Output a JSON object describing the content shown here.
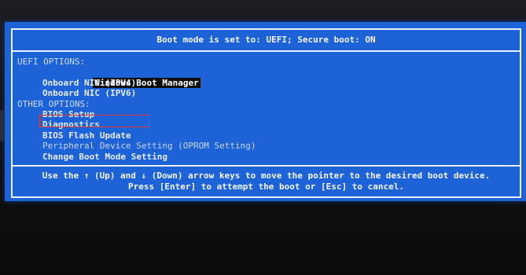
{
  "header": {
    "title": "Boot mode is set to: UEFI; Secure boot: ON"
  },
  "menu": {
    "uefi_section": "UEFI OPTIONS:",
    "uefi_items": [
      {
        "label": "Windows Boot Manager"
      },
      {
        "label": "Onboard NIC (IPV4)"
      },
      {
        "label": "Onboard NIC (IPV6)"
      }
    ],
    "other_section": "OTHER OPTIONS:",
    "other_items": [
      {
        "label": "BIOS Setup"
      },
      {
        "label": "Diagnostics"
      },
      {
        "label": "BIOS Flash Update"
      },
      {
        "label": "Peripheral Device Setting (OPROM Setting)"
      },
      {
        "label": "Change Boot Mode Setting"
      }
    ]
  },
  "footer": {
    "line1": "Use the ↑ (Up) and ↓ (Down) arrow keys to move the pointer to the desired boot device.",
    "line2": "Press [Enter] to attempt the boot or [Esc] to cancel."
  },
  "colors": {
    "panel_blue": "#1d62d6",
    "text": "#f4f6fb",
    "highlight_box": "#e23a3a",
    "selected_bg": "#0d0d10"
  }
}
